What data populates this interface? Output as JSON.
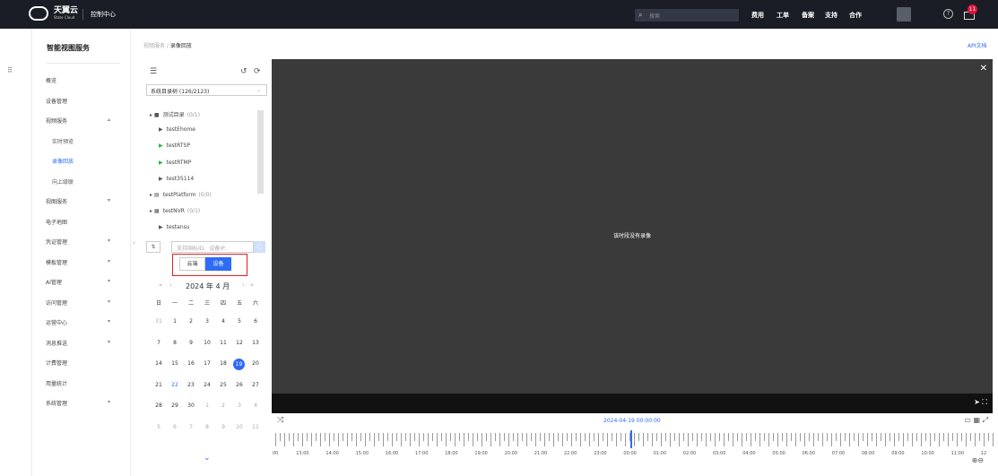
{
  "header": {
    "brand": "天翼云",
    "brand_sub": "State Cloud",
    "console": "控制中心",
    "search_placeholder": "搜索",
    "nav": [
      "费用",
      "工单",
      "备案",
      "支持",
      "合作"
    ],
    "help_glyph": "?",
    "badge": "11"
  },
  "sidebar": {
    "title": "智能视图服务",
    "items": [
      {
        "label": "概览",
        "sub": false,
        "active": false,
        "chev": ""
      },
      {
        "label": "设备管理",
        "sub": false,
        "active": false,
        "chev": ""
      },
      {
        "label": "视频服务",
        "sub": false,
        "active": false,
        "chev": "▴"
      },
      {
        "label": "实时预览",
        "sub": true,
        "active": false,
        "chev": ""
      },
      {
        "label": "录像回放",
        "sub": true,
        "active": true,
        "chev": ""
      },
      {
        "label": "向上级联",
        "sub": true,
        "active": false,
        "chev": ""
      },
      {
        "label": "视图服务",
        "sub": false,
        "active": false,
        "chev": "▾"
      },
      {
        "label": "电子地图",
        "sub": false,
        "active": false,
        "chev": ""
      },
      {
        "label": "凭证管理",
        "sub": false,
        "active": false,
        "chev": "▾"
      },
      {
        "label": "模板管理",
        "sub": false,
        "active": false,
        "chev": "▾"
      },
      {
        "label": "AI管理",
        "sub": false,
        "active": false,
        "chev": "▾"
      },
      {
        "label": "访问管理",
        "sub": false,
        "active": false,
        "chev": "▾"
      },
      {
        "label": "运营中心",
        "sub": false,
        "active": false,
        "chev": "▾"
      },
      {
        "label": "消息推送",
        "sub": false,
        "active": false,
        "chev": "▾"
      },
      {
        "label": "计费管理",
        "sub": false,
        "active": false,
        "chev": ""
      },
      {
        "label": "用量统计",
        "sub": false,
        "active": false,
        "chev": ""
      },
      {
        "label": "系统管理",
        "sub": false,
        "active": false,
        "chev": "▾"
      }
    ]
  },
  "breadcrumb": {
    "parent": "视频服务",
    "sep": " / ",
    "current": "录像回放"
  },
  "api_doc": "API文档",
  "panel": {
    "catalog_select": "系统目录树 (126/2123)",
    "tree": [
      {
        "label": "测试目录",
        "count": "(0/1)",
        "indent": 0,
        "icon": "folder-icon",
        "glyph": "▸ ■"
      },
      {
        "label": "testEhome",
        "count": "",
        "indent": 1,
        "icon": "camera-icon",
        "glyph": "▶"
      },
      {
        "label": "testRTSP",
        "count": "",
        "indent": 1,
        "icon": "camera-online-icon",
        "glyph": "▶"
      },
      {
        "label": "testRTMP",
        "count": "",
        "indent": 1,
        "icon": "camera-online-icon",
        "glyph": "▶"
      },
      {
        "label": "test35114",
        "count": "",
        "indent": 1,
        "icon": "camera-icon",
        "glyph": "▶"
      },
      {
        "label": "testPlatform",
        "count": "(0/0)",
        "indent": 0,
        "icon": "platform-icon",
        "glyph": "▸ ▤"
      },
      {
        "label": "testNVR",
        "count": "(0/1)",
        "indent": 0,
        "icon": "nvr-icon",
        "glyph": "▸ ▦"
      },
      {
        "label": "testansu",
        "count": "",
        "indent": 1,
        "icon": "camera-icon",
        "glyph": "▶"
      }
    ],
    "search_placeholder": "支持国标ID、设备IP、",
    "toggle": {
      "cloud": "云端",
      "device": "设备"
    },
    "month_label": "2024 年  4 月",
    "weekdays": [
      "日",
      "一",
      "二",
      "三",
      "四",
      "五",
      "六"
    ],
    "days": [
      [
        "31",
        "1",
        "2",
        "3",
        "4",
        "5",
        "6"
      ],
      [
        "7",
        "8",
        "9",
        "10",
        "11",
        "12",
        "13"
      ],
      [
        "14",
        "15",
        "16",
        "17",
        "18",
        "19",
        "20"
      ],
      [
        "21",
        "22",
        "23",
        "24",
        "25",
        "26",
        "27"
      ],
      [
        "28",
        "29",
        "30",
        "1",
        "2",
        "3",
        "4"
      ],
      [
        "5",
        "6",
        "7",
        "8",
        "9",
        "10",
        "11"
      ]
    ],
    "selected_day": "19",
    "today_day": "22"
  },
  "player": {
    "no_record": "该时段没有录像"
  },
  "timeline": {
    "datetime": "2024-04-19 00:00:00",
    "hours": [
      "00",
      "13:00",
      "14:00",
      "15:00",
      "16:00",
      "17:00",
      "18:00",
      "19:00",
      "20:00",
      "21:00",
      "22:00",
      "23:00",
      "00:00",
      "01:00",
      "02:00",
      "03:00",
      "04:00",
      "05:00",
      "06:00",
      "07:00",
      "08:00",
      "09:00",
      "10:00",
      "11:00",
      "12"
    ]
  },
  "colors": {
    "accent": "#2f6bf5",
    "topbar": "#1a1d26",
    "player_bg": "#3a3a3a",
    "highlight_box": "#e02020"
  }
}
